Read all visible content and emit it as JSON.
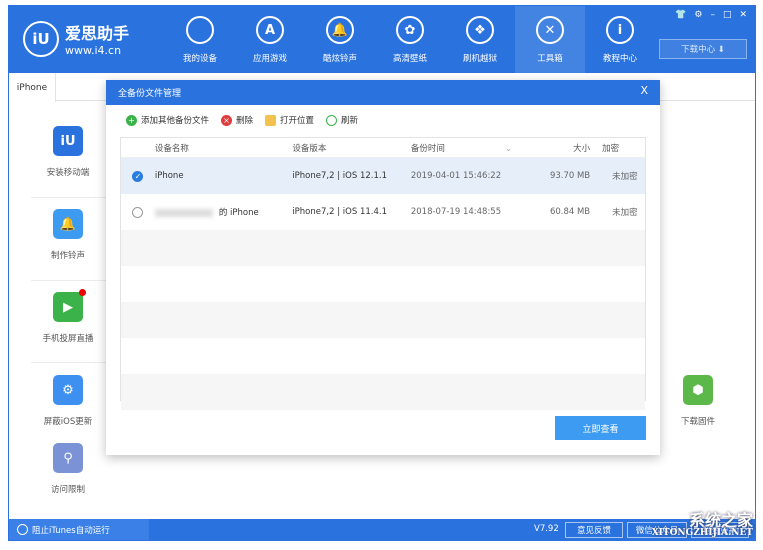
{
  "app": {
    "name": "爱思助手",
    "url": "www.i4.cn",
    "logo": "iU"
  },
  "nav": [
    {
      "label": "我的设备",
      "icon": "apple-icon"
    },
    {
      "label": "应用游戏",
      "icon": "app-store-icon"
    },
    {
      "label": "酷炫铃声",
      "icon": "bell-icon"
    },
    {
      "label": "高清壁纸",
      "icon": "flower-icon"
    },
    {
      "label": "刷机越狱",
      "icon": "dropbox-icon"
    },
    {
      "label": "工具箱",
      "icon": "tools-icon",
      "active": true
    },
    {
      "label": "教程中心",
      "icon": "info-icon"
    }
  ],
  "window_controls": [
    "shirt-icon",
    "gear-icon",
    "minimize-icon",
    "maximize-icon",
    "close-icon"
  ],
  "download_center": "下载中心 ⬇",
  "tab": "iPhone",
  "tools_left": [
    {
      "label": "安装移动端",
      "color": "#2a72de"
    },
    {
      "label": "制作铃声",
      "color": "#3d9cf2"
    },
    {
      "label": "手机投屏直播",
      "color": "#3cb34a"
    },
    {
      "label": "屏蔽iOS更新",
      "color": "#3d8ff0"
    },
    {
      "label": "访问限制",
      "color": "#7b93d6"
    }
  ],
  "tools_right": [
    {
      "label": "下载固件",
      "color": "#5cb849"
    }
  ],
  "dialog": {
    "title": "全备份文件管理",
    "close": "X",
    "toolbar": {
      "add": "添加其他备份文件",
      "delete": "删除",
      "open": "打开位置",
      "refresh": "刷新"
    },
    "columns": [
      "设备名称",
      "设备版本",
      "备份时间",
      "大小",
      "加密"
    ],
    "rows": [
      {
        "selected": true,
        "name": "iPhone",
        "version": "iPhone7,2 | iOS 12.1.1",
        "time": "2019-04-01 15:46:22",
        "size": "93.70 MB",
        "encrypt": "未加密"
      },
      {
        "selected": false,
        "name": "的 iPhone",
        "version": "iPhone7,2 | iOS 11.4.1",
        "time": "2018-07-19 14:48:55",
        "size": "60.84 MB",
        "encrypt": "未加密"
      }
    ],
    "view_button": "立即查看"
  },
  "status": {
    "itunes": "阻止iTunes自动运行",
    "version": "V7.92",
    "feedback": "意见反馈",
    "wechat": "微信公众号",
    "update": "检查更新"
  },
  "watermark": {
    "line1": "系统之家",
    "line2": "XITONGZHIJIA.NET"
  },
  "colors": {
    "brand": "#2a72de",
    "button": "#3d9cf2",
    "selected_row": "#e6eefa"
  }
}
